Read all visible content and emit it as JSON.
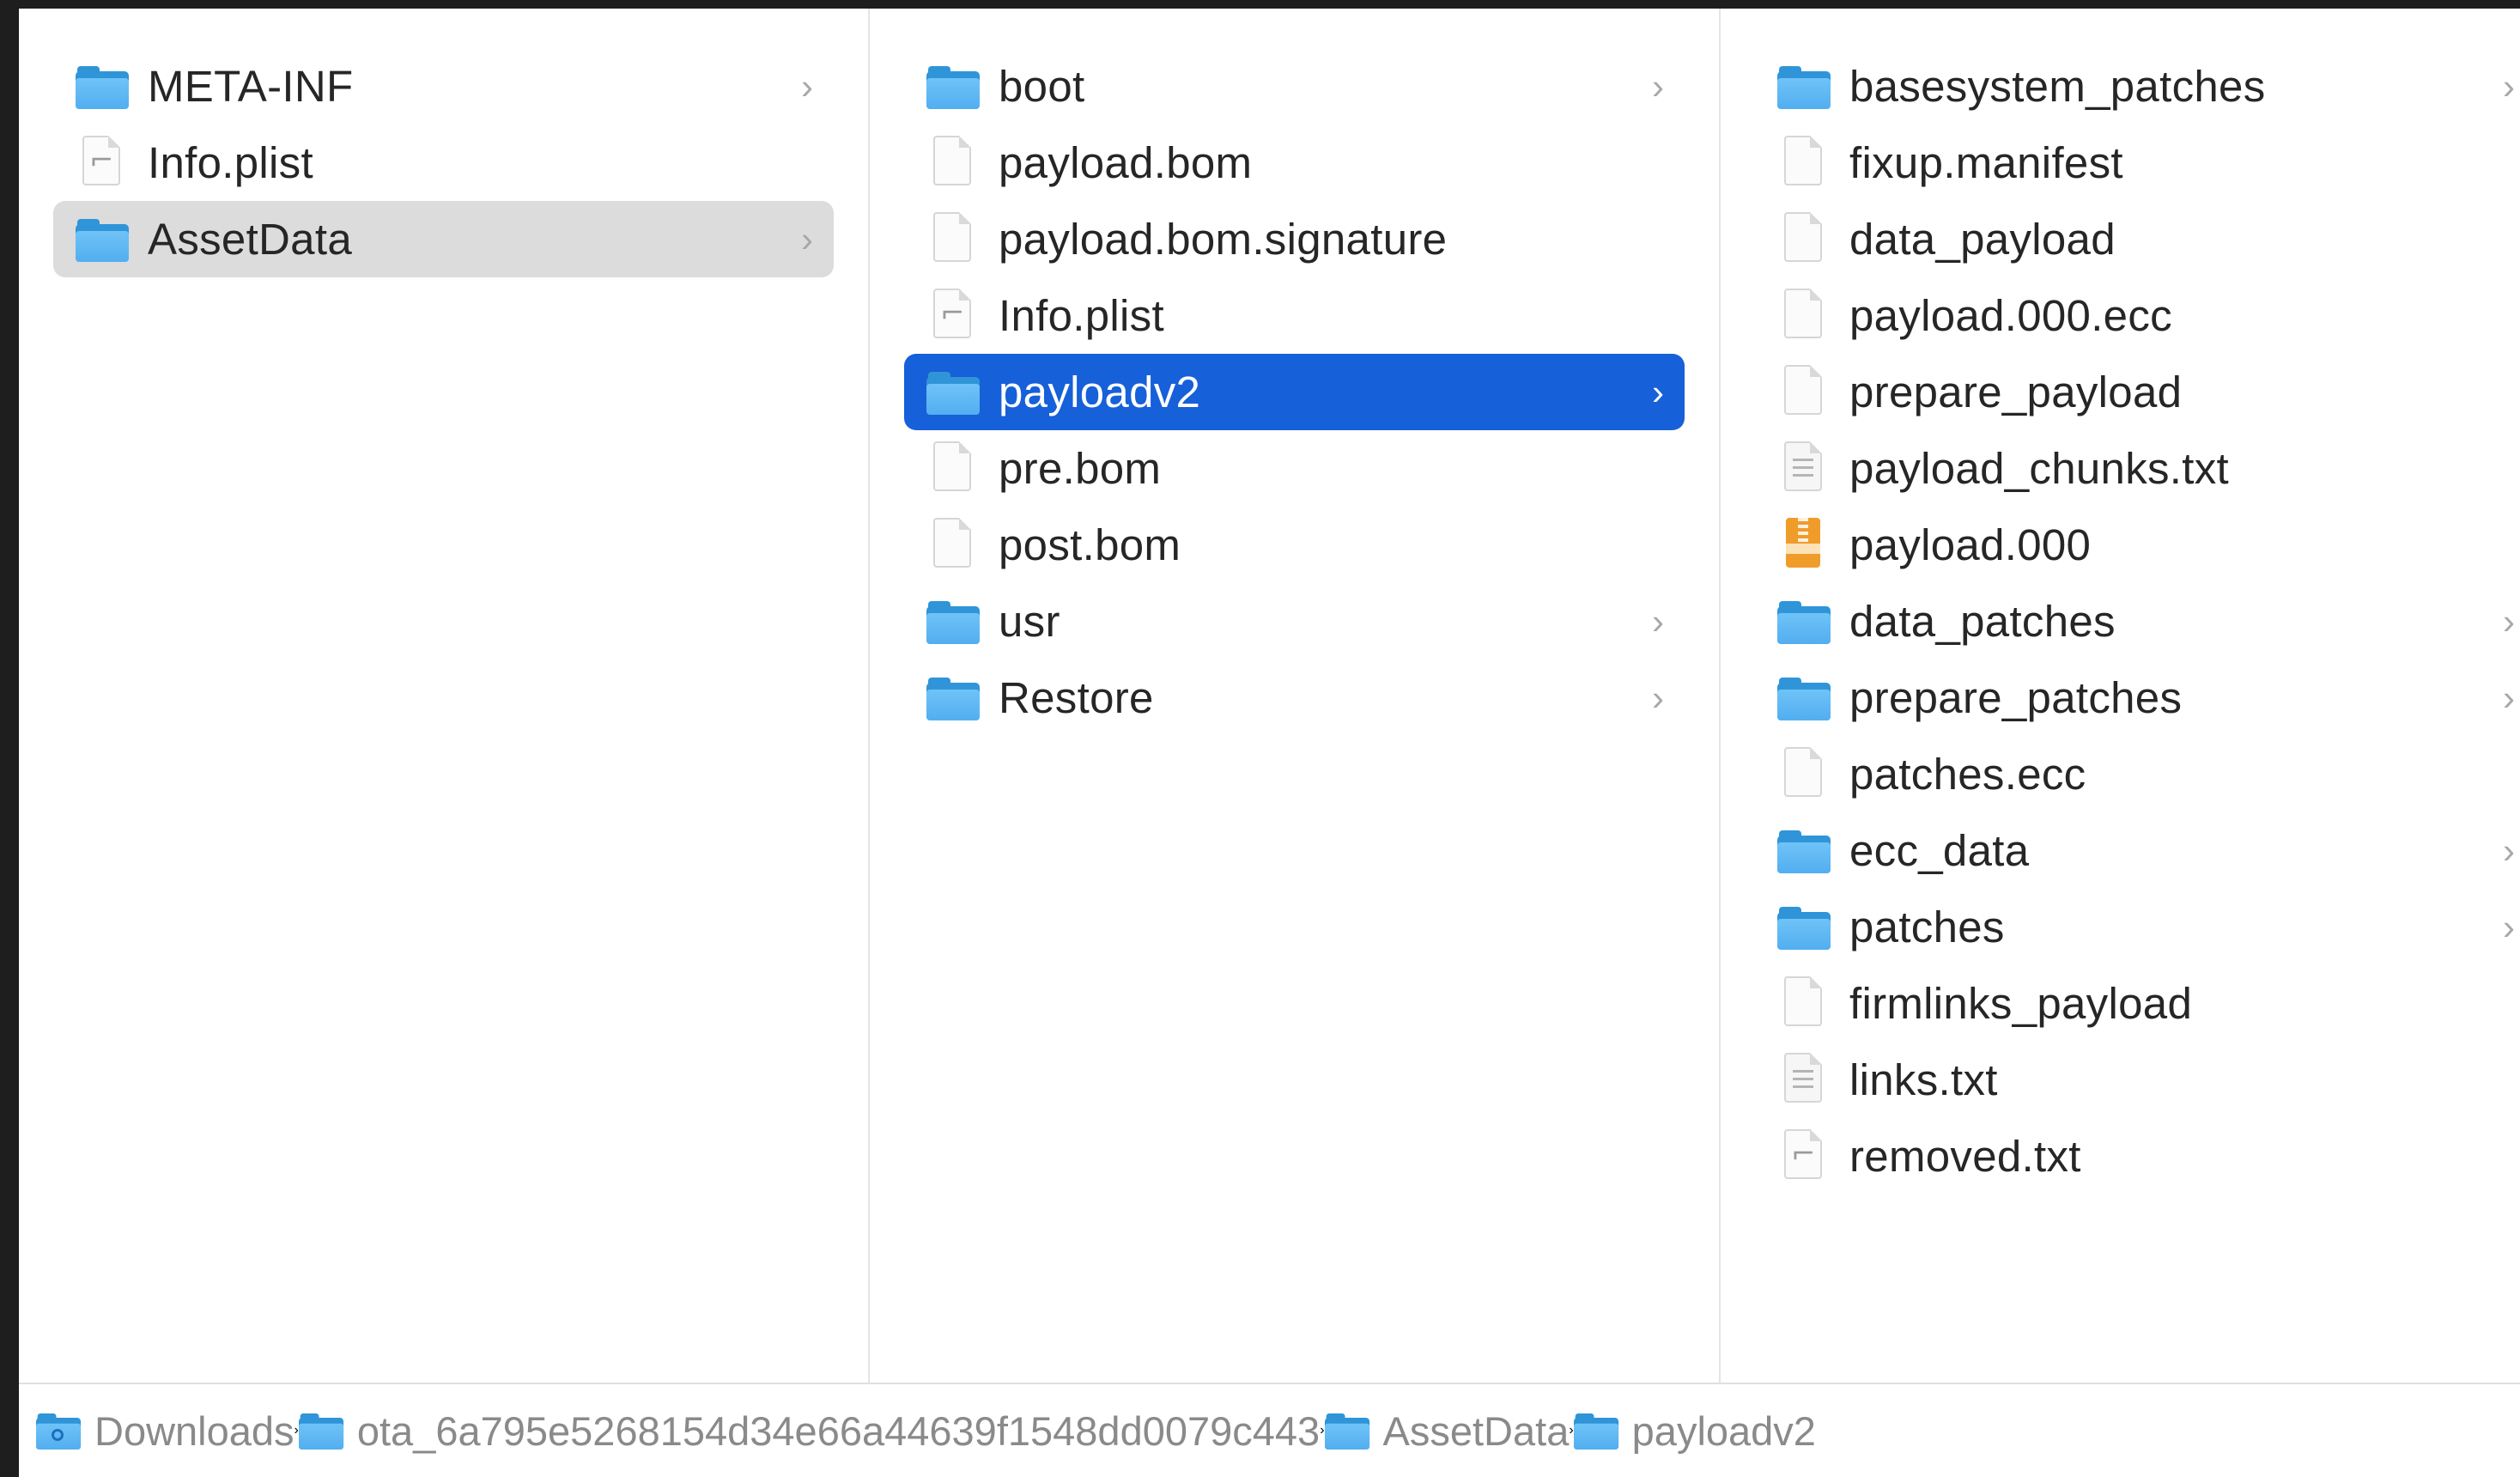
{
  "columns": [
    {
      "items": [
        {
          "label": "META-INF",
          "kind": "folder",
          "chevron": "›",
          "state": "normal"
        },
        {
          "label": "Info.plist",
          "kind": "plist",
          "state": "normal"
        },
        {
          "label": "AssetData",
          "kind": "folder",
          "chevron": "›",
          "state": "selected-inactive"
        }
      ]
    },
    {
      "items": [
        {
          "label": "boot",
          "kind": "folder",
          "chevron": "›",
          "state": "normal"
        },
        {
          "label": "payload.bom",
          "kind": "file",
          "state": "normal"
        },
        {
          "label": "payload.bom.signature",
          "kind": "file",
          "state": "normal"
        },
        {
          "label": "Info.plist",
          "kind": "plist",
          "state": "normal"
        },
        {
          "label": "payloadv2",
          "kind": "folder",
          "chevron": "›",
          "state": "selected-active"
        },
        {
          "label": "pre.bom",
          "kind": "file",
          "state": "normal"
        },
        {
          "label": "post.bom",
          "kind": "file",
          "state": "normal"
        },
        {
          "label": "usr",
          "kind": "folder",
          "chevron": "›",
          "state": "normal"
        },
        {
          "label": "Restore",
          "kind": "folder",
          "chevron": "›",
          "state": "normal"
        }
      ]
    },
    {
      "items": [
        {
          "label": "basesystem_patches",
          "kind": "folder",
          "chevron": "›",
          "state": "normal"
        },
        {
          "label": "fixup.manifest",
          "kind": "file",
          "state": "normal"
        },
        {
          "label": "data_payload",
          "kind": "file",
          "state": "normal"
        },
        {
          "label": "payload.000.ecc",
          "kind": "file",
          "state": "normal"
        },
        {
          "label": "prepare_payload",
          "kind": "file",
          "state": "normal"
        },
        {
          "label": "payload_chunks.txt",
          "kind": "text",
          "state": "normal"
        },
        {
          "label": "payload.000",
          "kind": "archive",
          "state": "normal"
        },
        {
          "label": "data_patches",
          "kind": "folder",
          "chevron": "›",
          "state": "normal"
        },
        {
          "label": "prepare_patches",
          "kind": "folder",
          "chevron": "›",
          "state": "normal"
        },
        {
          "label": "patches.ecc",
          "kind": "file",
          "state": "normal"
        },
        {
          "label": "ecc_data",
          "kind": "folder",
          "chevron": "›",
          "state": "normal"
        },
        {
          "label": "patches",
          "kind": "folder",
          "chevron": "›",
          "state": "normal"
        },
        {
          "label": "firmlinks_payload",
          "kind": "file",
          "state": "normal"
        },
        {
          "label": "links.txt",
          "kind": "text",
          "state": "normal"
        },
        {
          "label": "removed.txt",
          "kind": "plist",
          "state": "normal"
        }
      ]
    }
  ],
  "pathbar": {
    "separator": "›",
    "crumbs": [
      {
        "label": "Downloads",
        "icon": "downloads-folder-icon"
      },
      {
        "label": "ota_6a795e5268154d34e66a44639f1548dd0079c443",
        "icon": "folder-icon"
      },
      {
        "label": "AssetData",
        "icon": "folder-icon"
      },
      {
        "label": "payloadv2",
        "icon": "folder-icon"
      }
    ]
  },
  "colors": {
    "selection_active": "#1660d9",
    "selection_inactive": "#dcdcdc",
    "folder_blue": "#52aef0",
    "archive_orange": "#f09c2b",
    "text": "#262626",
    "pathbar_text": "#8a8a8a"
  }
}
